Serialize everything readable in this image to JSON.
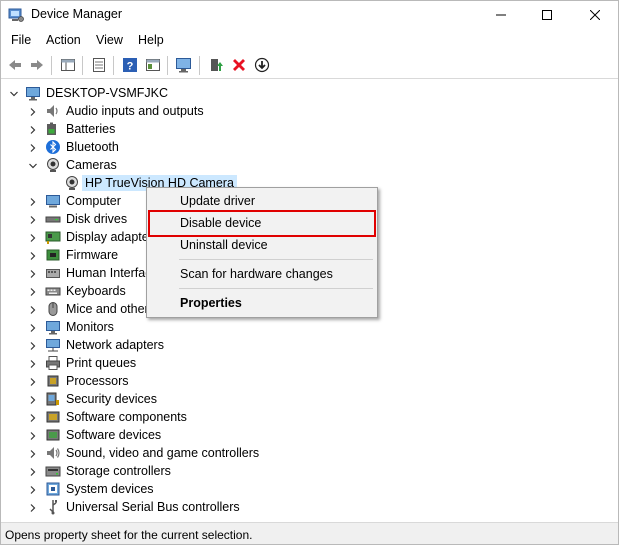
{
  "window": {
    "title": "Device Manager",
    "icon": "device-manager-icon"
  },
  "menu": {
    "items": [
      "File",
      "Action",
      "View",
      "Help"
    ]
  },
  "toolbar": {
    "icons": [
      "back-arrow-icon",
      "forward-arrow-icon",
      "properties-sheet-icon",
      "list-view-icon",
      "help-icon",
      "details-icon",
      "monitor-scan-icon",
      "update-driver-icon",
      "uninstall-x-icon",
      "download-icon"
    ]
  },
  "tree": {
    "root": "DESKTOP-VSMFJKC",
    "categories": [
      {
        "label": "Audio inputs and outputs",
        "icon": "speaker-icon",
        "expanded": false
      },
      {
        "label": "Batteries",
        "icon": "battery-icon",
        "expanded": false
      },
      {
        "label": "Bluetooth",
        "icon": "bluetooth-icon",
        "expanded": false
      },
      {
        "label": "Cameras",
        "icon": "camera-icon",
        "expanded": true
      },
      {
        "label": "Computer",
        "icon": "computer-icon",
        "expanded": false
      },
      {
        "label": "Disk drives",
        "icon": "disk-drive-icon",
        "expanded": false
      },
      {
        "label": "Display adapter",
        "icon": "display-adapter-icon",
        "expanded": false
      },
      {
        "label": "Firmware",
        "icon": "firmware-icon",
        "expanded": false
      },
      {
        "label": "Human Interfac",
        "icon": "hid-icon",
        "expanded": false
      },
      {
        "label": "Keyboards",
        "icon": "keyboard-icon",
        "expanded": false
      },
      {
        "label": "Mice and other",
        "icon": "mouse-icon",
        "expanded": false
      },
      {
        "label": "Monitors",
        "icon": "monitor-icon",
        "expanded": false
      },
      {
        "label": "Network adapters",
        "icon": "network-icon",
        "expanded": false
      },
      {
        "label": "Print queues",
        "icon": "printer-icon",
        "expanded": false
      },
      {
        "label": "Processors",
        "icon": "processor-icon",
        "expanded": false
      },
      {
        "label": "Security devices",
        "icon": "security-icon",
        "expanded": false
      },
      {
        "label": "Software components",
        "icon": "software-component-icon",
        "expanded": false
      },
      {
        "label": "Software devices",
        "icon": "software-device-icon",
        "expanded": false
      },
      {
        "label": "Sound, video and game controllers",
        "icon": "sound-icon",
        "expanded": false
      },
      {
        "label": "Storage controllers",
        "icon": "storage-icon",
        "expanded": false
      },
      {
        "label": "System devices",
        "icon": "system-device-icon",
        "expanded": false
      },
      {
        "label": "Universal Serial Bus controllers",
        "icon": "usb-icon",
        "expanded": false
      }
    ],
    "camera_child": "HP TrueVision HD Camera"
  },
  "context_menu": {
    "items": [
      "Update driver",
      "Disable device",
      "Uninstall device",
      "Scan for hardware changes",
      "Properties"
    ],
    "highlighted": "Disable device",
    "highlight_color": "#e00000"
  },
  "status": {
    "text": "Opens property sheet for the current selection."
  },
  "colors": {
    "selection": "#cce8ff",
    "menu_bg": "#f2f2f2",
    "highlight": "#e00000"
  }
}
